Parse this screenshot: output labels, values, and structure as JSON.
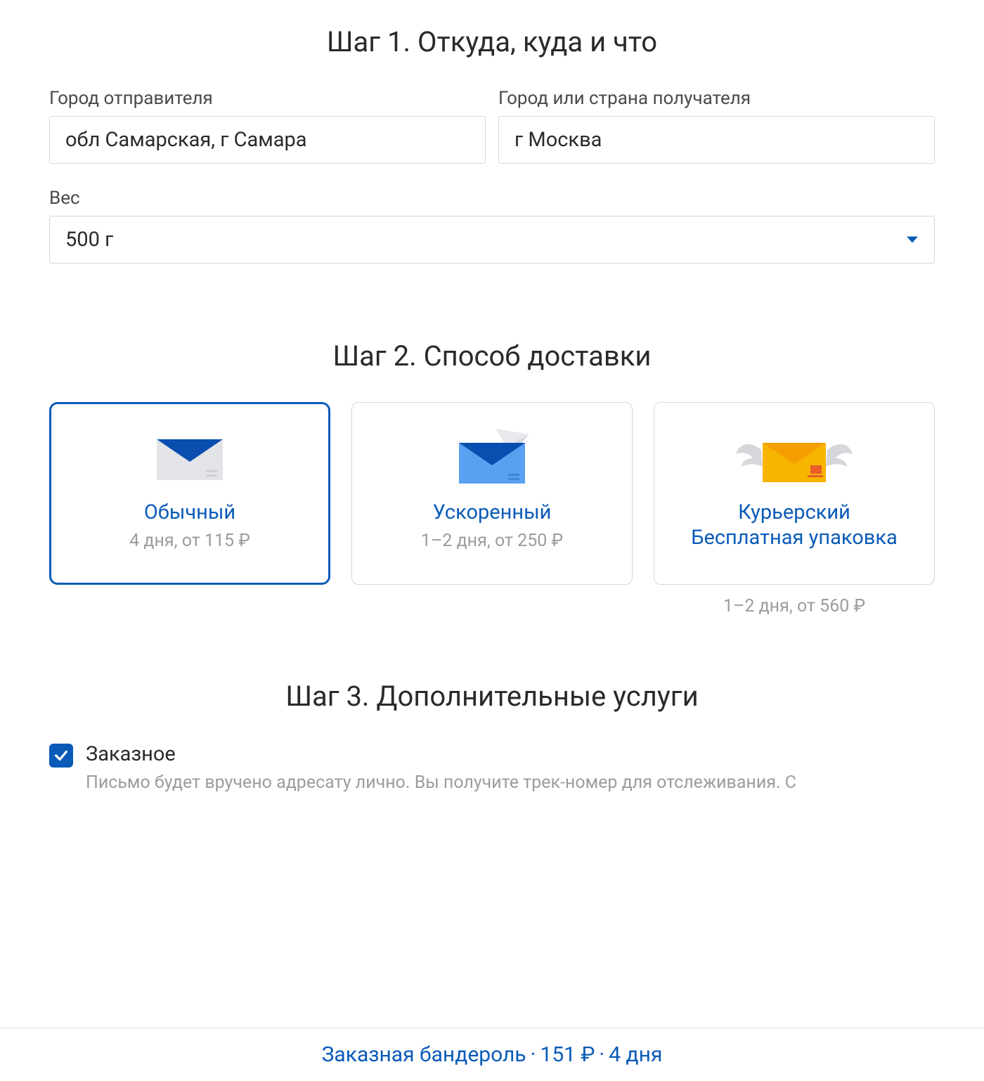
{
  "step1": {
    "title": "Шаг 1. Откуда, куда и что",
    "from_label": "Город отправителя",
    "from_value": "обл Самарская, г Самара",
    "to_label": "Город или страна получателя",
    "to_value": "г Москва",
    "weight_label": "Вес",
    "weight_value": "500 г"
  },
  "step2": {
    "title": "Шаг 2. Способ доставки",
    "cards": [
      {
        "title": "Обычный",
        "sub": "4 дня, от 115 ₽",
        "selected": true
      },
      {
        "title": "Ускоренный",
        "sub": "1–2 дня, от 250 ₽",
        "selected": false
      },
      {
        "title_line1": "Курьерский",
        "title_line2": "Бесплатная упаковка",
        "outside_sub": "1–2 дня, от 560 ₽",
        "selected": false
      }
    ]
  },
  "step3": {
    "title": "Шаг 3. Дополнительные услуги",
    "option": {
      "checked": true,
      "label": "Заказное",
      "desc": "Письмо будет вручено адресату лично. Вы получите трек-номер для отслеживания. С"
    }
  },
  "footer": {
    "product": "Заказная бандероль",
    "price": "151 ₽",
    "time": "4 дня"
  }
}
